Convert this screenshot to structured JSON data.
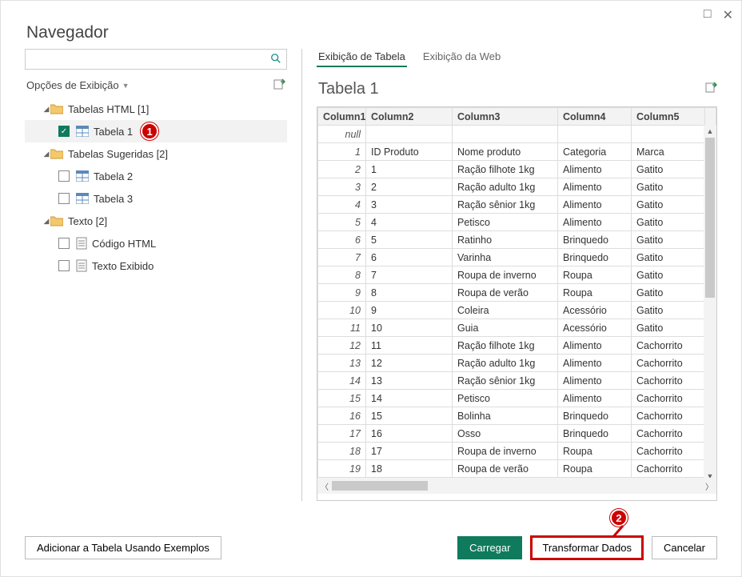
{
  "title": "Navegador",
  "options_label": "Opções de Exibição",
  "tree": {
    "group1": {
      "label": "Tabelas HTML [1]"
    },
    "tabela1": {
      "label": "Tabela 1"
    },
    "group2": {
      "label": "Tabelas Sugeridas [2]"
    },
    "tabela2": {
      "label": "Tabela 2"
    },
    "tabela3": {
      "label": "Tabela 3"
    },
    "group3": {
      "label": "Texto [2]"
    },
    "codigo": {
      "label": "Código HTML"
    },
    "textoex": {
      "label": "Texto Exibido"
    }
  },
  "tabs": {
    "table_view": "Exibição de Tabela",
    "web_view": "Exibição da Web"
  },
  "preview_title": "Tabela 1",
  "columns": {
    "c1": "Column1",
    "c2": "Column2",
    "c3": "Column3",
    "c4": "Column4",
    "c5": "Column5"
  },
  "null_label": "null",
  "rows": [
    {
      "n": "1",
      "c2": "ID Produto",
      "c3": "Nome produto",
      "c4": "Categoria",
      "c5": "Marca"
    },
    {
      "n": "2",
      "c2": "1",
      "c3": "Ração filhote 1kg",
      "c4": "Alimento",
      "c5": "Gatito"
    },
    {
      "n": "3",
      "c2": "2",
      "c3": "Ração adulto 1kg",
      "c4": "Alimento",
      "c5": "Gatito"
    },
    {
      "n": "4",
      "c2": "3",
      "c3": "Ração sênior 1kg",
      "c4": "Alimento",
      "c5": "Gatito"
    },
    {
      "n": "5",
      "c2": "4",
      "c3": "Petisco",
      "c4": "Alimento",
      "c5": "Gatito"
    },
    {
      "n": "6",
      "c2": "5",
      "c3": "Ratinho",
      "c4": "Brinquedo",
      "c5": "Gatito"
    },
    {
      "n": "7",
      "c2": "6",
      "c3": "Varinha",
      "c4": "Brinquedo",
      "c5": "Gatito"
    },
    {
      "n": "8",
      "c2": "7",
      "c3": "Roupa de inverno",
      "c4": "Roupa",
      "c5": "Gatito"
    },
    {
      "n": "9",
      "c2": "8",
      "c3": "Roupa de verão",
      "c4": "Roupa",
      "c5": "Gatito"
    },
    {
      "n": "10",
      "c2": "9",
      "c3": "Coleira",
      "c4": "Acessório",
      "c5": "Gatito"
    },
    {
      "n": "11",
      "c2": "10",
      "c3": "Guia",
      "c4": "Acessório",
      "c5": "Gatito"
    },
    {
      "n": "12",
      "c2": "11",
      "c3": "Ração filhote 1kg",
      "c4": "Alimento",
      "c5": "Cachorrito"
    },
    {
      "n": "13",
      "c2": "12",
      "c3": "Ração adulto 1kg",
      "c4": "Alimento",
      "c5": "Cachorrito"
    },
    {
      "n": "14",
      "c2": "13",
      "c3": "Ração sênior 1kg",
      "c4": "Alimento",
      "c5": "Cachorrito"
    },
    {
      "n": "15",
      "c2": "14",
      "c3": "Petisco",
      "c4": "Alimento",
      "c5": "Cachorrito"
    },
    {
      "n": "16",
      "c2": "15",
      "c3": "Bolinha",
      "c4": "Brinquedo",
      "c5": "Cachorrito"
    },
    {
      "n": "17",
      "c2": "16",
      "c3": "Osso",
      "c4": "Brinquedo",
      "c5": "Cachorrito"
    },
    {
      "n": "18",
      "c2": "17",
      "c3": "Roupa de inverno",
      "c4": "Roupa",
      "c5": "Cachorrito"
    },
    {
      "n": "19",
      "c2": "18",
      "c3": "Roupa de verão",
      "c4": "Roupa",
      "c5": "Cachorrito"
    }
  ],
  "buttons": {
    "add_example": "Adicionar a Tabela Usando Exemplos",
    "load": "Carregar",
    "transform": "Transformar Dados",
    "cancel": "Cancelar"
  },
  "callouts": {
    "one": "1",
    "two": "2"
  }
}
